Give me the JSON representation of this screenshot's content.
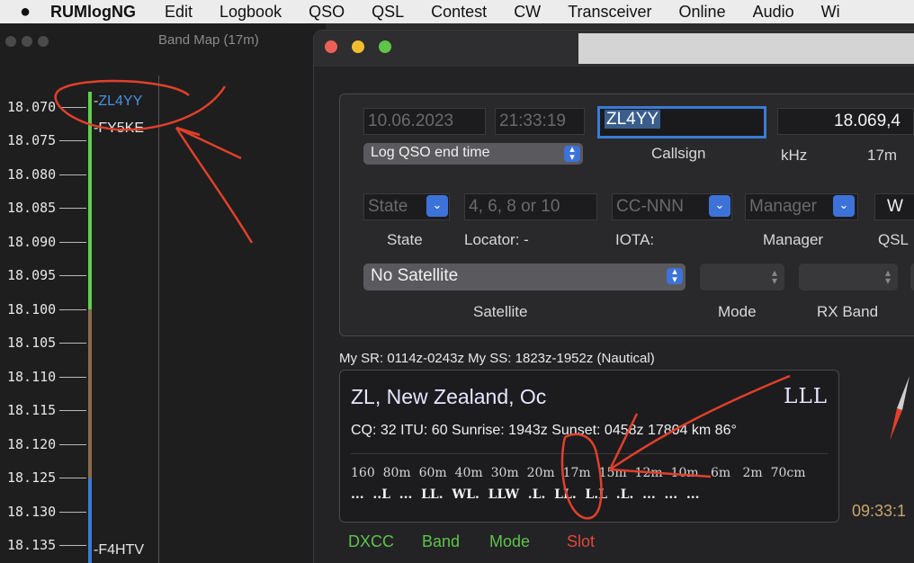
{
  "menubar": {
    "apple_icon": "apple-icon",
    "app_name": "RUMlogNG",
    "items": [
      "Edit",
      "Logbook",
      "QSO",
      "QSL",
      "Contest",
      "CW",
      "Transceiver",
      "Online",
      "Audio",
      "Wi"
    ]
  },
  "bandmap": {
    "title": "Band Map (17m)",
    "frequencies": [
      "18.070",
      "18.075",
      "18.080",
      "18.085",
      "18.090",
      "18.095",
      "18.100",
      "18.105",
      "18.110",
      "18.115",
      "18.120",
      "18.125",
      "18.130",
      "18.135"
    ],
    "spots": [
      {
        "callsign": "ZL4YY",
        "color": "#4a90e2"
      },
      {
        "callsign": "FY5KE",
        "color": "#e6e6e6"
      },
      {
        "callsign": "F4HTV",
        "color": "#e6e6e6"
      }
    ],
    "segment_colors": {
      "cw": "#5fcf4f",
      "digital": "#8a6a4a",
      "phone": "#3a7bd5"
    }
  },
  "qso": {
    "date": "10.06.2023",
    "time": "21:33:19",
    "callsign": "ZL4YY",
    "frequency": "18.069,4",
    "end_time_option": "Log QSO end time",
    "callsign_label": "Callsign",
    "khz_label": "kHz",
    "band_label": "17m",
    "state_placeholder": "State",
    "state_label": "State",
    "locator_placeholder": "4, 6, 8 or 10",
    "locator_label": "Locator: -",
    "iota_placeholder": "CC-NNN",
    "iota_label": "IOTA:",
    "manager_placeholder": "Manager",
    "manager_label": "Manager",
    "qsl_value": "W",
    "qsl_label": "QSL",
    "satellite_value": "No Satellite",
    "satellite_label": "Satellite",
    "mode_label": "Mode",
    "rx_band_label": "RX Band"
  },
  "sun": {
    "text": "My SR: 0114z-0243z  My SS: 1823z-1952z (Nautical)"
  },
  "dxcc": {
    "name": "ZL, New Zealand, Oc",
    "code": "LLL",
    "stats": "CQ: 32  ITU: 60  Sunrise: 1943z  Sunset: 0458z  17804 km  86°",
    "bands": "160  80m  60m  40m  30m  20m  17m  15m  12m  10m   6m   2m  70cm",
    "slots": "...  ..L  ...  LL.  WL.  LLW  .L.  LL.  L.L  .L.  ...  ...  ..."
  },
  "legend": [
    {
      "label": "DXCC",
      "color": "#5fc24a"
    },
    {
      "label": "Band",
      "color": "#5fc24a"
    },
    {
      "label": "Mode",
      "color": "#5fc24a"
    },
    {
      "label": "Slot",
      "color": "#e0473a"
    }
  ],
  "clock": "09:33:1",
  "colors": {
    "accent": "#3d73d8",
    "annotation": "#e0402a"
  }
}
